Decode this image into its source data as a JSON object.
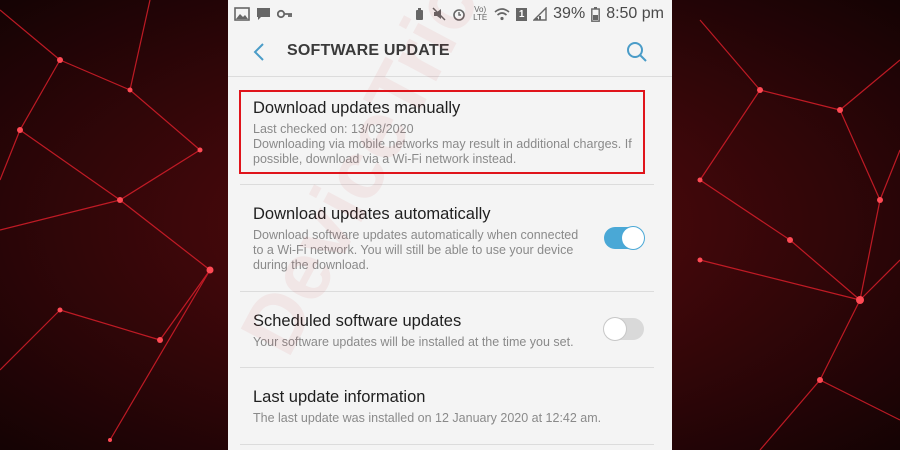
{
  "status_bar": {
    "battery": "39%",
    "time": "8:50 pm",
    "network_label": "Vo) LTE",
    "sim": "1"
  },
  "app_bar": {
    "title": "SOFTWARE UPDATE"
  },
  "settings": [
    {
      "title": "Download updates manually",
      "subtitle": "Last checked on: 13/03/2020",
      "description": "Downloading via mobile networks may result in additional charges. If possible, download via a Wi-Fi network instead."
    },
    {
      "title": "Download updates automatically",
      "description": "Download software updates automatically when connected to a Wi-Fi network. You will still be able to use your device during the download.",
      "toggle_on": true
    },
    {
      "title": "Scheduled software updates",
      "description": "Your software updates will be installed at the time you set.",
      "toggle_on": false
    },
    {
      "title": "Last update information",
      "description": "The last update was installed on 12 January 2020 at 12:42 am."
    }
  ],
  "colors": {
    "accent": "#4aa8d6",
    "highlight": "#e0141b",
    "background_red": "#c4141c"
  },
  "watermark": "DeviceTricks"
}
